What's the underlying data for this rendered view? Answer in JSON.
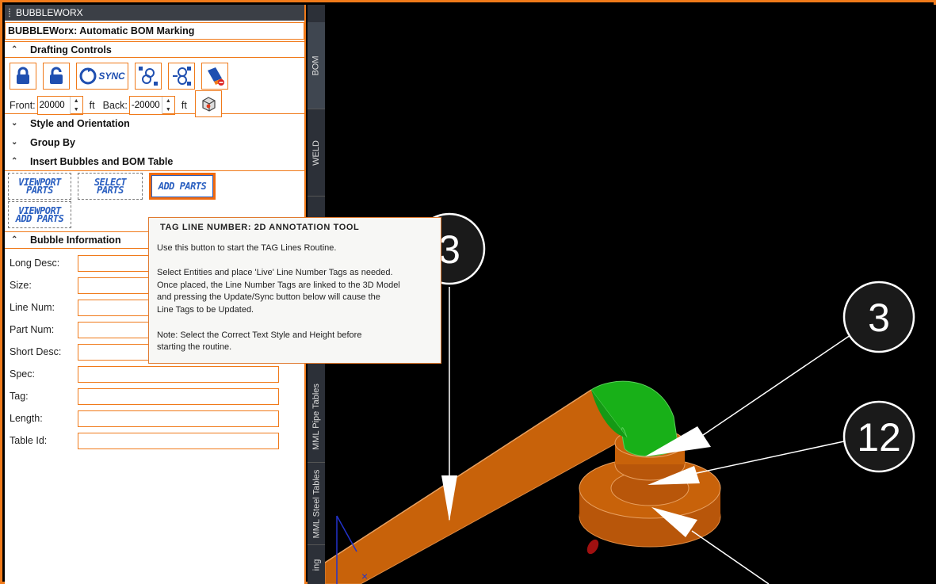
{
  "window": {
    "title": "BUBBLEWORX"
  },
  "panel": {
    "header": "BUBBLEWorx: Automatic BOM Marking",
    "drafting": {
      "label": "Drafting Controls",
      "sync_label": "SYNC",
      "front_label": "Front:",
      "front_value": "20000",
      "back_label": "Back:",
      "back_value": "-20000",
      "unit": "ft"
    },
    "sections": {
      "style": "Style and Orientation",
      "group": "Group By",
      "insert": "Insert Bubbles and BOM Table",
      "bubble": "Bubble Information"
    },
    "insert_buttons": {
      "viewport_parts": "VIEWPORT\nPARTS",
      "select_parts": "SELECT\nPARTS",
      "add_parts": "ADD PARTS",
      "viewport_add_parts": "VIEWPORT\nADD PARTS"
    },
    "fields": [
      {
        "label": "Long Desc:",
        "value": ""
      },
      {
        "label": "Size:",
        "value": ""
      },
      {
        "label": "Line Num:",
        "value": ""
      },
      {
        "label": "Part Num:",
        "value": ""
      },
      {
        "label": "Short Desc:",
        "value": ""
      },
      {
        "label": "Spec:",
        "value": ""
      },
      {
        "label": "Tag:",
        "value": ""
      },
      {
        "label": "Length:",
        "value": ""
      },
      {
        "label": "Table Id:",
        "value": ""
      }
    ]
  },
  "side_tabs": [
    "BOM",
    "WELD",
    "MML Pipe Tables",
    "MML Steel Tables",
    "ing"
  ],
  "tooltip": {
    "title": "TAG LINE NUMBER: 2D ANNOTATION TOOL",
    "p1": "Use this button to start the TAG Lines Routine.",
    "p2": "Select Entities and place 'Live' Line Number Tags as needed.\nOnce placed, the Line Number Tags are linked to the 3D Model\nand pressing the Update/Sync button below will cause the\nLine Tags to be Updated.",
    "p3": "Note: Select the Correct Text Style and Height before\nstarting the routine."
  },
  "viewport": {
    "bubbles": [
      "3",
      "3",
      "12"
    ],
    "colors": {
      "pipe": "#c8620a",
      "elbow": "#18b018",
      "accent": "#f07a1a"
    }
  }
}
